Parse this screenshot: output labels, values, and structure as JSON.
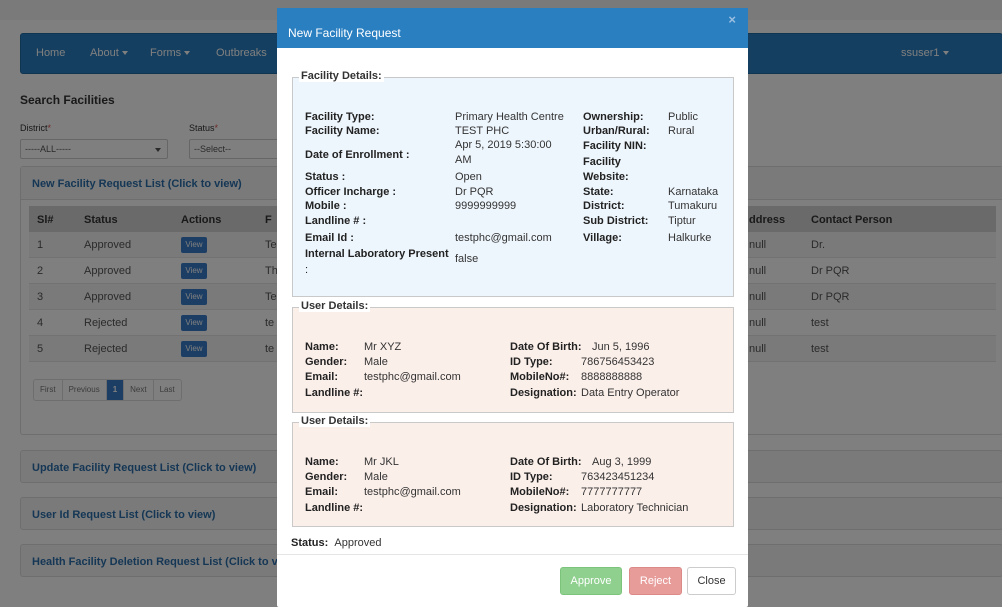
{
  "navbar": {
    "items": [
      {
        "label": "Home",
        "dropdown": false
      },
      {
        "label": "About",
        "dropdown": true
      },
      {
        "label": "Forms",
        "dropdown": true
      },
      {
        "label": "Outbreaks",
        "dropdown": false
      }
    ],
    "user": "ssuser1"
  },
  "search": {
    "title": "Search Facilities",
    "district_label": "District",
    "district_value": "-----ALL-----",
    "status_label": "Status",
    "status_value": "--Select--"
  },
  "panels": {
    "new_requests": "New Facility Request List (Click to view)",
    "update_requests": "Update Facility Request List (Click to view)",
    "user_id_requests": "User Id Request List (Click to view)",
    "deletion_requests": "Health Facility Deletion Request List (Click to v"
  },
  "table": {
    "headers": {
      "sl": "Sl#",
      "status": "Status",
      "actions": "Actions",
      "facility_cut": "F",
      "address_cut": "ddress",
      "contact": "Contact Person"
    },
    "view_label": "View",
    "rows": [
      {
        "sl": "1",
        "status": "Approved",
        "facility_cut": "Te",
        "address_cut": "null",
        "contact": "Dr."
      },
      {
        "sl": "2",
        "status": "Approved",
        "facility_cut": "Th",
        "address_cut": "null",
        "contact": "Dr PQR"
      },
      {
        "sl": "3",
        "status": "Approved",
        "facility_cut": "Te",
        "address_cut": "null",
        "contact": "Dr PQR"
      },
      {
        "sl": "4",
        "status": "Rejected",
        "facility_cut": "te",
        "address_cut": "null",
        "contact": "test"
      },
      {
        "sl": "5",
        "status": "Rejected",
        "facility_cut": "te",
        "address_cut": "null",
        "contact": "test"
      }
    ]
  },
  "pagination": {
    "first": "First",
    "previous": "Previous",
    "current": "1",
    "next": "Next",
    "last": "Last"
  },
  "modal": {
    "title": "New Facility Request",
    "close_glyph": "×",
    "facility_legend": "Facility Details:",
    "facility": {
      "type_label": "Facility Type:",
      "type_value": "Primary Health Centre",
      "name_label": "Facility Name:",
      "name_value": "TEST PHC",
      "enroll_label": "Date of Enrollment :",
      "enroll_value_1": "Apr 5, 2019 5:30:00",
      "enroll_value_2": "AM",
      "status_label": "Status :",
      "status_value": "Open",
      "officer_label": "Officer Incharge :",
      "officer_value": "Dr PQR",
      "mobile_label": "Mobile :",
      "mobile_value": "9999999999",
      "landline_label": "Landline # :",
      "email_label": "Email Id :",
      "email_value": "testphc@gmail.com",
      "lab_label_1": "Internal Laboratory Present",
      "lab_label_2": ":",
      "lab_value": "false",
      "ownership_label": "Ownership:",
      "ownership_value": "Public",
      "urban_label": "Urban/Rural:",
      "urban_value": "Rural",
      "nin_label_1": "Facility NIN:",
      "nin_label_2": "Facility",
      "website_label": "Website:",
      "state_label": "State:",
      "state_value": "Karnataka",
      "district_label": "District:",
      "district_value": "Tumakuru",
      "subdistrict_label": "Sub District:",
      "subdistrict_value": "Tiptur",
      "village_label": "Village:",
      "village_value": "Halkurke"
    },
    "users": [
      {
        "legend": "User Details:",
        "name_label": "Name:",
        "name_value": "Mr XYZ",
        "gender_label": "Gender:",
        "gender_value": "Male",
        "email_label": "Email:",
        "email_value": "testphc@gmail.com",
        "landline_label": "Landline #:",
        "dob_label": "Date Of Birth:",
        "dob_value": "Jun 5, 1996",
        "idtype_label": "ID Type:",
        "idtype_value": "786756453423",
        "mobile_label": "MobileNo#:",
        "mobile_value": "8888888888",
        "designation_label": "Designation:",
        "designation_value": "Data Entry Operator"
      },
      {
        "legend": "User Details:",
        "name_label": "Name:",
        "name_value": "Mr JKL",
        "gender_label": "Gender:",
        "gender_value": "Male",
        "email_label": "Email:",
        "email_value": "testphc@gmail.com",
        "landline_label": "Landline #:",
        "dob_label": "Date Of Birth:",
        "dob_value": "Aug 3, 1999",
        "idtype_label": "ID Type:",
        "idtype_value": "763423451234",
        "mobile_label": "MobileNo#:",
        "mobile_value": "7777777777",
        "designation_label": "Designation:",
        "designation_value": "Laboratory Technician"
      }
    ],
    "status_label": "Status:",
    "status_value": "Approved",
    "buttons": {
      "approve": "Approve",
      "reject": "Reject",
      "close": "Close"
    }
  },
  "colors": {
    "brand": "#2a7fc1",
    "link": "#2a6eaa",
    "approve": "#8fd08f",
    "reject": "#e79c9a"
  }
}
